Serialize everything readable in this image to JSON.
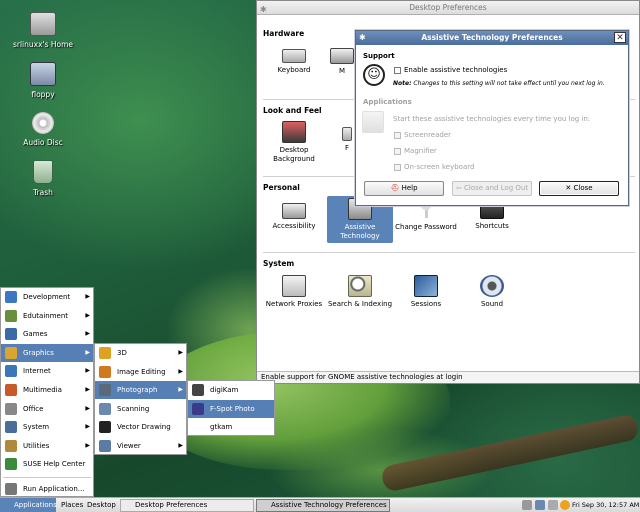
{
  "desktop": {
    "icons": [
      {
        "label": "srlinuxx's Home",
        "icon": "home-folder-icon"
      },
      {
        "label": "floppy",
        "icon": "floppy-icon"
      },
      {
        "label": "Audio Disc",
        "icon": "cd-icon"
      },
      {
        "label": "Trash",
        "icon": "trash-icon"
      }
    ]
  },
  "prefs": {
    "title": "Desktop Preferences",
    "sections": {
      "hardware": "Hardware",
      "look": "Look and Feel",
      "personal": "Personal",
      "system": "System"
    },
    "items": {
      "keyboard": "Keyboard",
      "mouse_partial": "M",
      "desktop_background": "Desktop Background",
      "font_partial": "F",
      "accessibility": "Accessibility",
      "assistive": "Assistive Technology",
      "password": "Change Password",
      "shortcuts": "Shortcuts",
      "proxies": "Network Proxies",
      "search": "Search & Indexing",
      "sessions": "Sessions",
      "sound": "Sound"
    },
    "status": "Enable support for GNOME assistive technologies at login"
  },
  "at_dialog": {
    "title": "Assistive Technology Preferences",
    "support_heading": "Support",
    "enable_label": "Enable assistive technologies",
    "note_bold": "Note:",
    "note_text": "Changes to this setting will not take effect until you next log in.",
    "apps_heading": "Applications",
    "apps_desc": "Start these assistive technologies every time you log in:",
    "screenreader": "Screenreader",
    "magnifier": "Magnifier",
    "keyboard": "On-screen keyboard",
    "help_btn": "Help",
    "close_logout_btn": "Close and Log Out",
    "close_btn": "Close"
  },
  "main_menu": [
    {
      "label": "Development",
      "icon": "development-icon",
      "color": "#3b78c4"
    },
    {
      "label": "Edutainment",
      "icon": "edutainment-icon",
      "color": "#6a8e3a"
    },
    {
      "label": "Games",
      "icon": "games-icon",
      "color": "#3a6aa8"
    },
    {
      "label": "Graphics",
      "icon": "graphics-icon",
      "color": "#d9a52a"
    },
    {
      "label": "Internet",
      "icon": "internet-icon",
      "color": "#3a77b8"
    },
    {
      "label": "Multimedia",
      "icon": "multimedia-icon",
      "color": "#c85a2a"
    },
    {
      "label": "Office",
      "icon": "office-icon",
      "color": "#888888"
    },
    {
      "label": "System",
      "icon": "system-icon",
      "color": "#4a6e9a"
    },
    {
      "label": "Utilities",
      "icon": "utilities-icon",
      "color": "#b08a3a"
    },
    {
      "label": "SUSE Help Center",
      "icon": "help-center-icon",
      "color": "#3a8a3a"
    },
    {
      "label": "Run Application...",
      "icon": "run-icon",
      "color": "#777777"
    }
  ],
  "graphics_menu": [
    {
      "label": "3D",
      "icon": "3d-icon",
      "color": "#e0a020"
    },
    {
      "label": "Image Editing",
      "icon": "image-editing-icon",
      "color": "#d07a20"
    },
    {
      "label": "Photograph",
      "icon": "photograph-icon",
      "color": "#5a6a7a"
    },
    {
      "label": "Scanning",
      "icon": "scanning-icon",
      "color": "#6a88b0"
    },
    {
      "label": "Vector Drawing",
      "icon": "vector-drawing-icon",
      "color": "#222222"
    },
    {
      "label": "Viewer",
      "icon": "viewer-icon",
      "color": "#5a7aa8"
    }
  ],
  "photo_menu": [
    {
      "label": "digiKam",
      "icon": "digikam-icon",
      "color": "#444444"
    },
    {
      "label": "F-Spot Photo Album",
      "icon": "fspot-icon",
      "color": "#3a3a8a"
    },
    {
      "label": "gtkam",
      "icon": "",
      "color": ""
    }
  ],
  "panel": {
    "applications": "Applications",
    "places": "Places",
    "desktop": "Desktop",
    "task1": "Desktop Preferences",
    "task2": "Assistive Technology Preferences",
    "clock": "Fri Sep 30, 12:57 AM"
  }
}
